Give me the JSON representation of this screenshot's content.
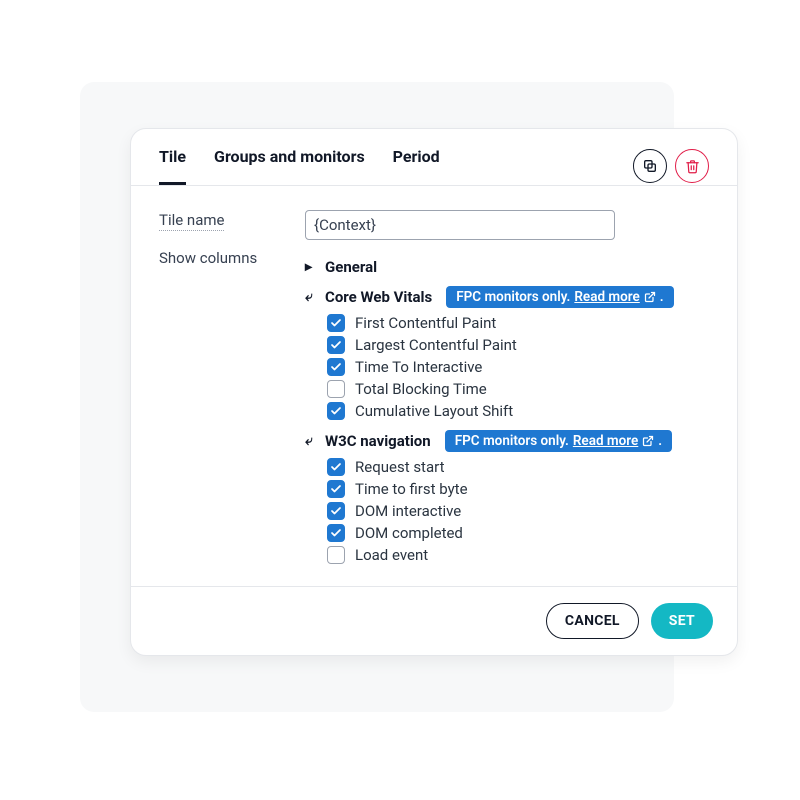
{
  "tabs": [
    "Tile",
    "Groups and monitors",
    "Period"
  ],
  "form": {
    "tile_name_label": "Tile name",
    "tile_name_value": "{Context}",
    "show_columns_label": "Show columns"
  },
  "badge": {
    "text": "FPC monitors only. ",
    "link": "Read more"
  },
  "groups": {
    "general": {
      "title": "General",
      "expanded": false
    },
    "cwv": {
      "title": "Core Web Vitals",
      "expanded": true,
      "items": [
        {
          "label": "First Contentful Paint",
          "checked": true
        },
        {
          "label": "Largest Contentful Paint",
          "checked": true
        },
        {
          "label": "Time To Interactive",
          "checked": true
        },
        {
          "label": "Total Blocking Time",
          "checked": false
        },
        {
          "label": "Cumulative Layout Shift",
          "checked": true
        }
      ]
    },
    "w3c": {
      "title": "W3C navigation",
      "expanded": true,
      "items": [
        {
          "label": "Request start",
          "checked": true
        },
        {
          "label": "Time to first byte",
          "checked": true
        },
        {
          "label": "DOM interactive",
          "checked": true
        },
        {
          "label": "DOM completed",
          "checked": true
        },
        {
          "label": "Load event",
          "checked": false
        }
      ]
    }
  },
  "footer": {
    "cancel": "CANCEL",
    "set": "SET"
  }
}
